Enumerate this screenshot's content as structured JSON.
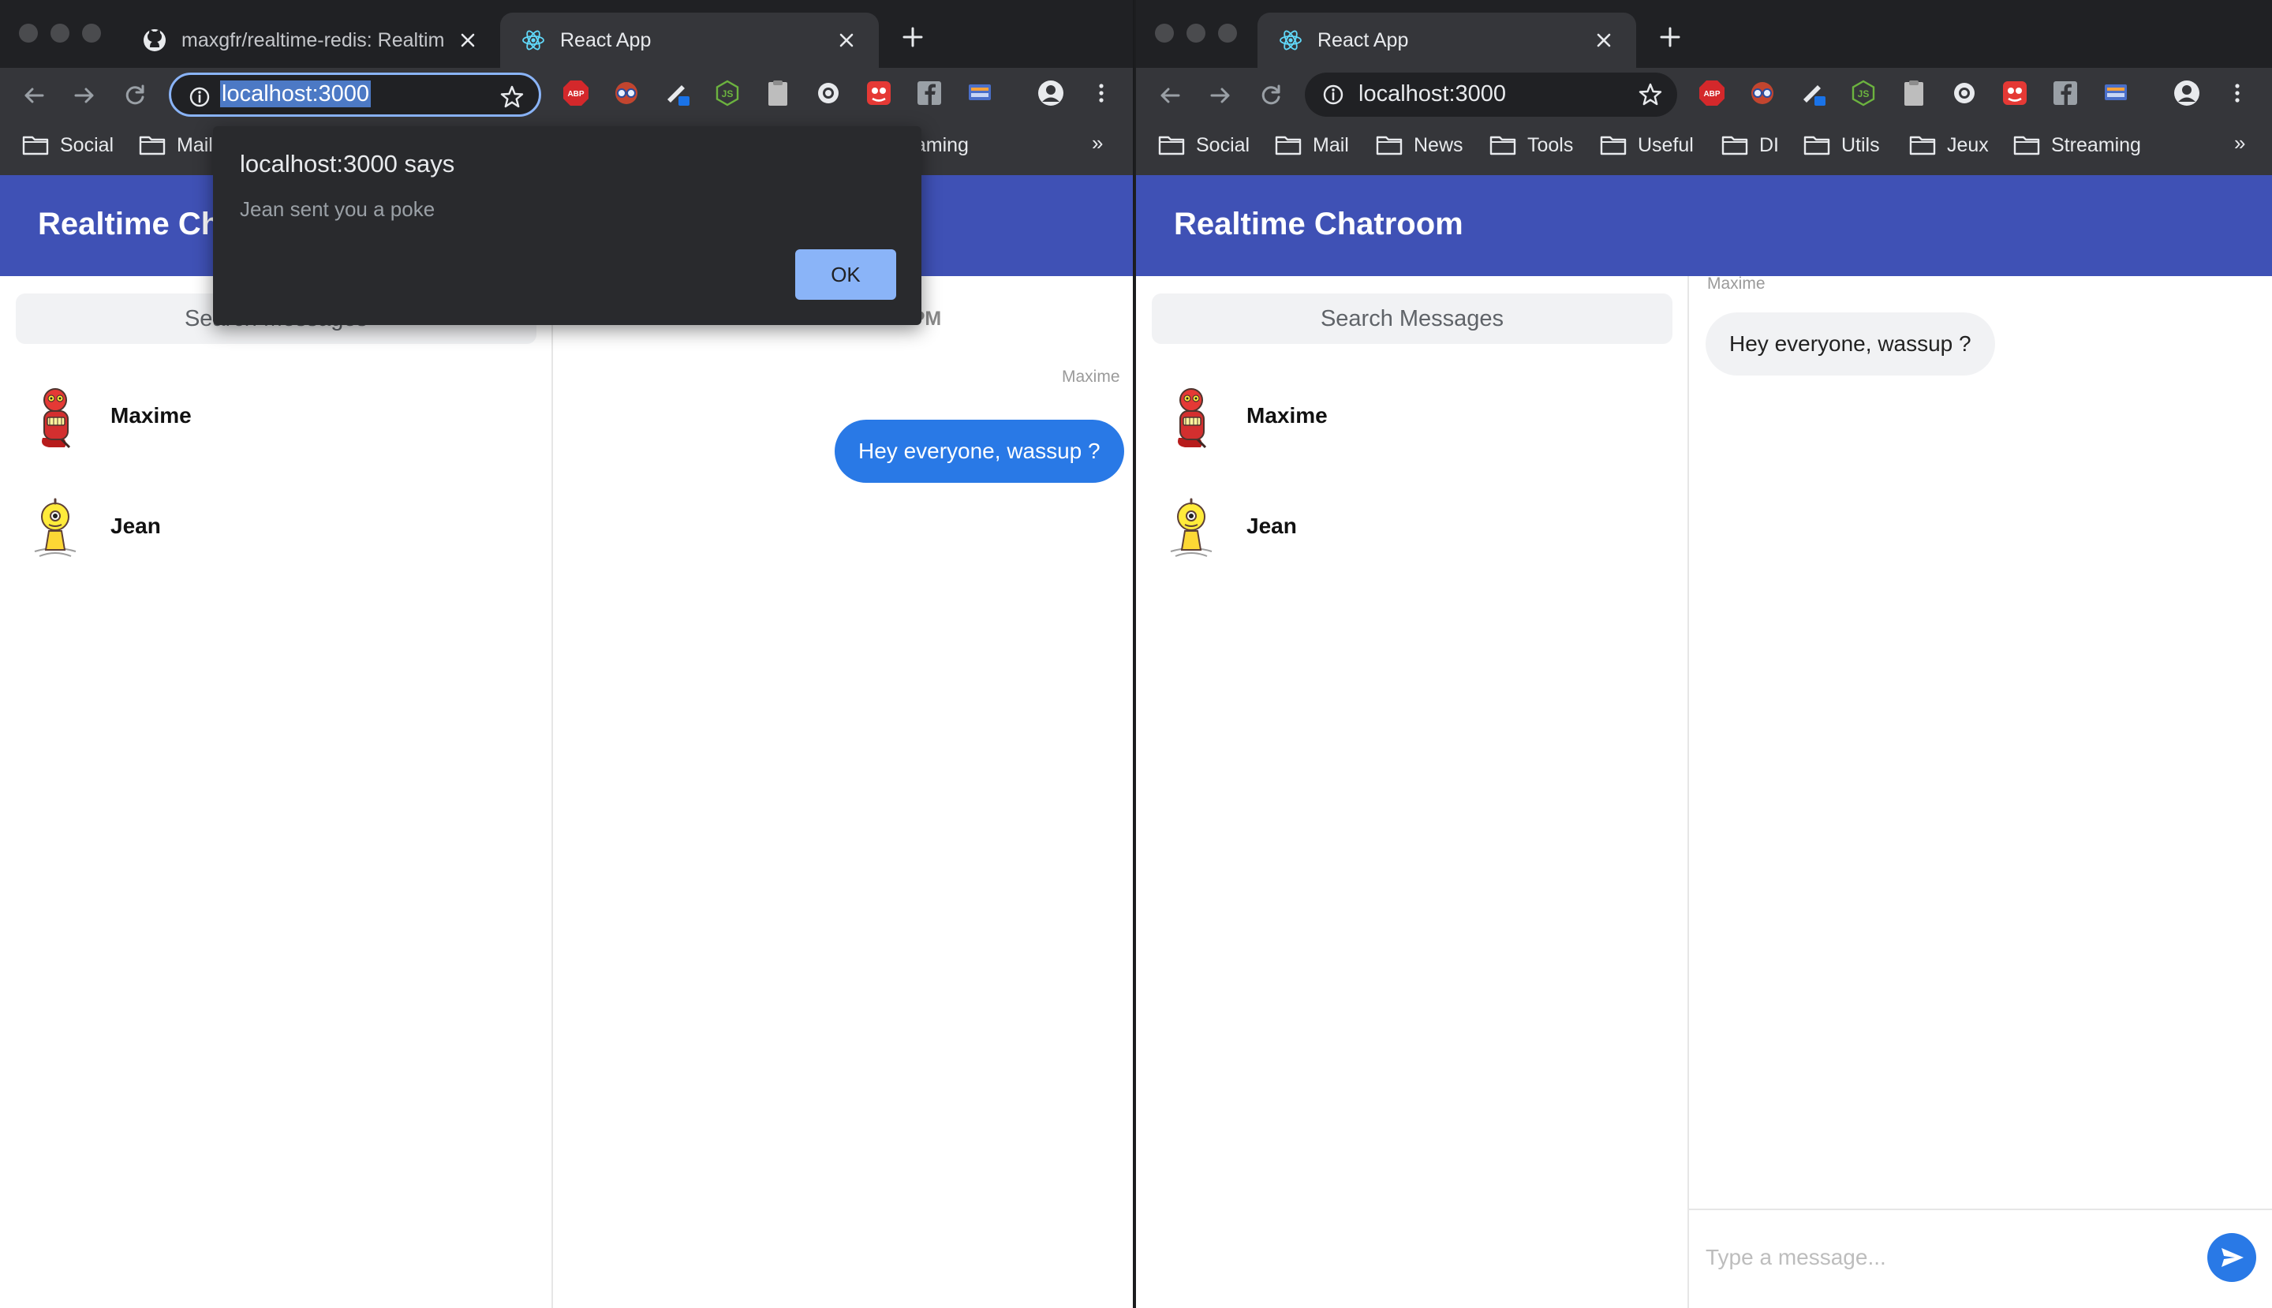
{
  "left_window": {
    "tabs": [
      {
        "title": "maxgfr/realtime-redis: Realtime",
        "icon": "github-icon",
        "active": false
      },
      {
        "title": "React App",
        "icon": "react-icon",
        "active": true
      }
    ],
    "url": "localhost:3000",
    "bookmarks": [
      "Social",
      "Mail",
      "Streaming"
    ],
    "app_title": "Realtime Chatroom",
    "search_placeholder": "Search Messages",
    "users": [
      {
        "name": "Maxime",
        "avatar": "red-robot-avatar"
      },
      {
        "name": "Jean",
        "avatar": "yellow-robot-avatar"
      }
    ],
    "date_separator": "Fri Jan 03 2020 11:03 PM",
    "messages": [
      {
        "sender": "Maxime",
        "text": "Hey everyone, wassup ?",
        "mine": true
      }
    ],
    "dialog": {
      "title": "localhost:3000 says",
      "message": "Jean sent you a poke",
      "ok_label": "OK"
    }
  },
  "right_window": {
    "tabs": [
      {
        "title": "React App",
        "icon": "react-icon",
        "active": true
      }
    ],
    "url": "localhost:3000",
    "bookmarks": [
      "Social",
      "Mail",
      "News",
      "Tools",
      "Useful",
      "DI",
      "Utils",
      "Jeux",
      "Streaming"
    ],
    "app_title": "Realtime Chatroom",
    "search_placeholder": "Search Messages",
    "users": [
      {
        "name": "Maxime",
        "avatar": "red-robot-avatar"
      },
      {
        "name": "Jean",
        "avatar": "yellow-robot-avatar"
      }
    ],
    "messages": [
      {
        "sender": "Maxime",
        "text": "Hey everyone, wassup ?",
        "mine": false
      }
    ],
    "composer_placeholder": "Type a message..."
  },
  "bookmarks_overflow": "»",
  "extensions": [
    "adblock-icon",
    "glasses-extension-icon",
    "pen-extension-icon",
    "nodejs-icon",
    "clipboard-icon",
    "circle-extension-icon",
    "red-extension-icon",
    "facebook-icon",
    "screen-extension-icon",
    "profile-icon",
    "menu-icon"
  ],
  "colors": {
    "chrome_dark": "#202124",
    "toolbar": "#35363a",
    "app_bar": "#3f51b5",
    "bubble_blue": "#2979e6",
    "bubble_grey": "#f1f2f4",
    "dialog_button": "#8ab4f8"
  }
}
